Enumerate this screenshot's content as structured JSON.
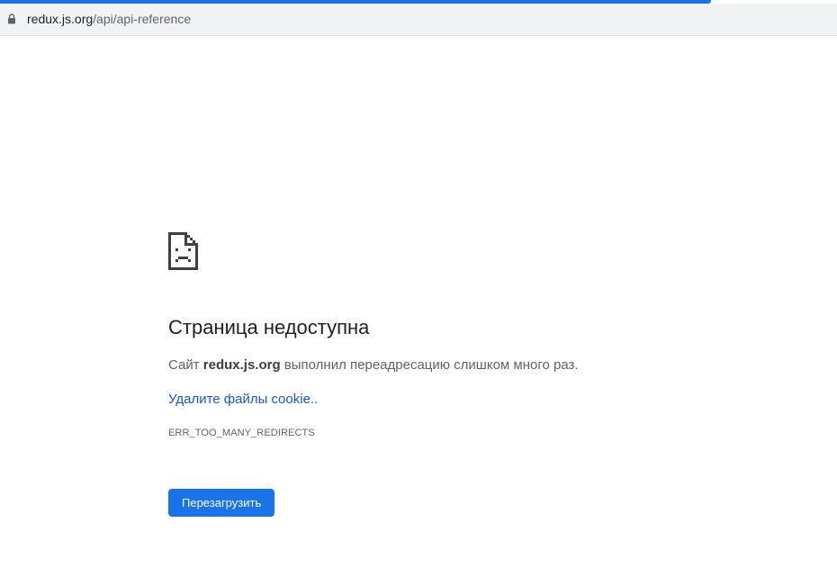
{
  "browser": {
    "url_host": "redux.js.org",
    "url_path": "/api/api-reference",
    "accent_color": "#1a73e8"
  },
  "error_page": {
    "icon": "sad-page-icon",
    "title": "Страница недоступна",
    "explanation_prefix": "Сайт ",
    "explanation_host": "redux.js.org",
    "explanation_suffix": " выполнил переадресацию слишком много раз.",
    "suggestion_link": "Удалите файлы cookie..",
    "error_code": "ERR_TOO_MANY_REDIRECTS",
    "reload_button": "Перезагрузить"
  }
}
